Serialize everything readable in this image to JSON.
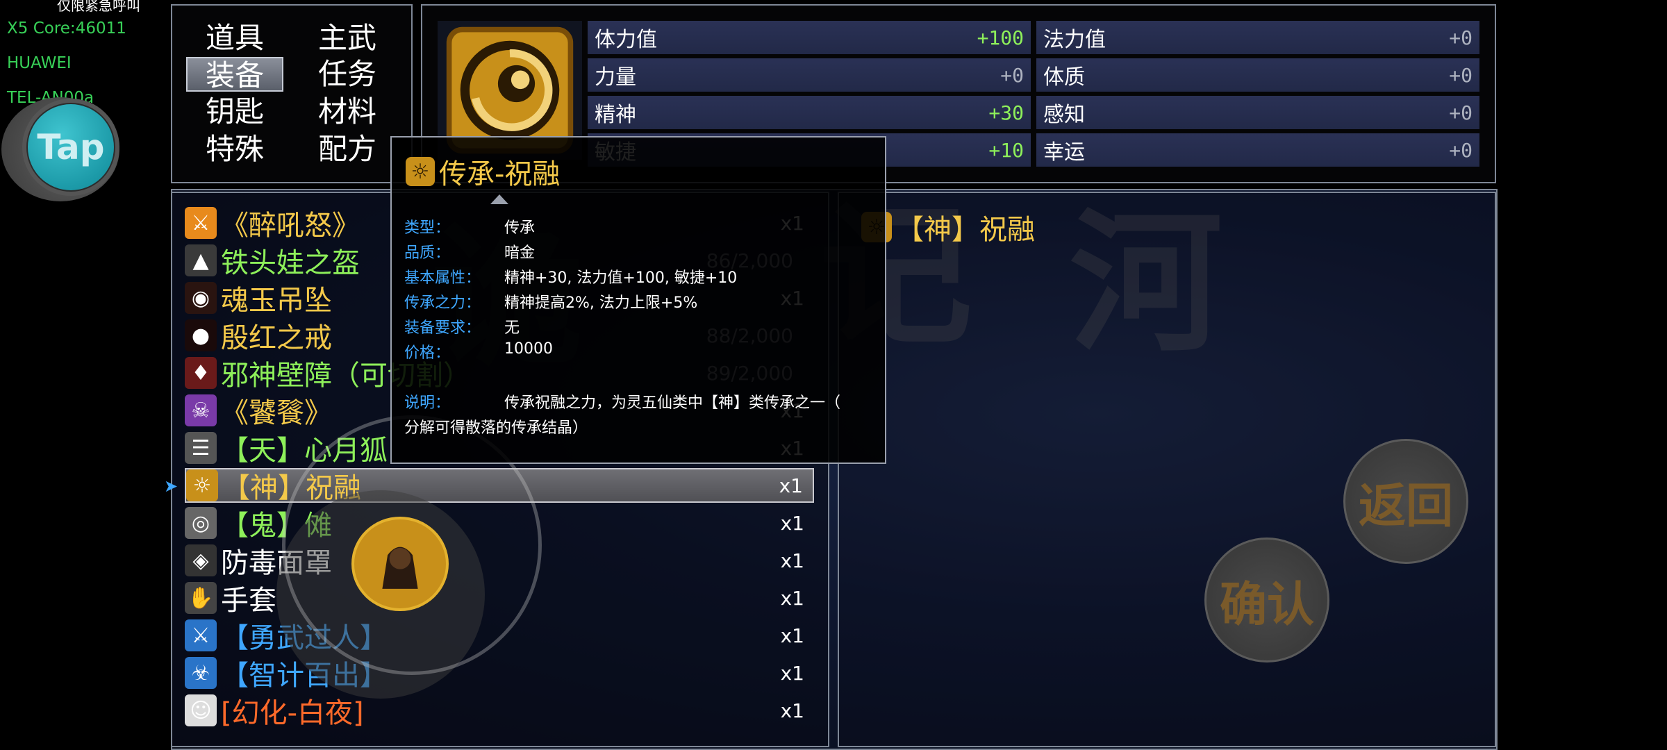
{
  "overlay": {
    "top_text": "仅限紧急呼叫",
    "lines": [
      "X5 Core:46011",
      "HUAWEI",
      "TEL-AN00a"
    ],
    "tap_label": "Tap"
  },
  "tabs": [
    "道具",
    "主武",
    "装备",
    "任务",
    "钥匙",
    "材料",
    "特殊",
    "配方"
  ],
  "active_tab": "装备",
  "stats": [
    {
      "label": "体力值",
      "value": "+100",
      "highlight": true
    },
    {
      "label": "法力值",
      "value": "+0",
      "highlight": false
    },
    {
      "label": "力量",
      "value": "+0",
      "highlight": false
    },
    {
      "label": "体质",
      "value": "+0",
      "highlight": false
    },
    {
      "label": "精神",
      "value": "+30",
      "highlight": true
    },
    {
      "label": "感知",
      "value": "+0",
      "highlight": false
    },
    {
      "label": "敏捷",
      "value": "+10",
      "highlight": true
    },
    {
      "label": "幸运",
      "value": "+0",
      "highlight": false
    }
  ],
  "items": [
    {
      "name": "《醉吼怒》",
      "color": "#f4c94a",
      "count": "x1",
      "icon": "tiger-icon"
    },
    {
      "name": "铁头娃之盔",
      "color": "#8ef05a",
      "count": "86/2,000",
      "icon": "helmet-icon"
    },
    {
      "name": "魂玉吊坠",
      "color": "#f4c94a",
      "count": "x1",
      "icon": "pendant-icon"
    },
    {
      "name": "殷红之戒",
      "color": "#f4c94a",
      "count": "88/2,000",
      "icon": "ring-icon"
    },
    {
      "name": "邪神壁障（可切割）",
      "color": "#8ef05a",
      "count": "89/2,000",
      "icon": "shield-icon"
    },
    {
      "name": "《饕餮》",
      "color": "#f4c94a",
      "count": "x1",
      "icon": "beast-icon"
    },
    {
      "name": "【天】心月狐",
      "color": "#8ef05a",
      "count": "x1",
      "icon": "fox-icon"
    },
    {
      "name": "【神】祝融",
      "color": "#f4c94a",
      "count": "x1",
      "icon": "sun-icon",
      "selected": true
    },
    {
      "name": "【鬼】傩",
      "color": "#8ef05a",
      "count": "x1",
      "icon": "mask-icon"
    },
    {
      "name": "防毒面罩",
      "color": "#ffffff",
      "count": "x1",
      "icon": "gasmask-icon"
    },
    {
      "name": "手套",
      "color": "#ffffff",
      "count": "x1",
      "icon": "glove-icon"
    },
    {
      "name": "【勇武过人】",
      "color": "#3fa7ff",
      "count": "x1",
      "icon": "sword-icon"
    },
    {
      "name": "【智计百出】",
      "color": "#3fa7ff",
      "count": "x1",
      "icon": "biohazard-icon"
    },
    {
      "name": "[幻化-白夜]",
      "color": "#ff6a2a",
      "count": "x1",
      "icon": "character-icon"
    }
  ],
  "tooltip": {
    "title": "传承-祝融",
    "fields": [
      {
        "label": "类型：",
        "value": "传承"
      },
      {
        "label": "品质：",
        "value": "暗金"
      },
      {
        "label": "基本属性：",
        "value": "精神+30, 法力值+100, 敏捷+10"
      },
      {
        "label": "传承之力：",
        "value": "精神提高2%, 法力上限+5%"
      },
      {
        "label": "装备要求：",
        "value": "无"
      },
      {
        "label": "价格：",
        "value": "10000"
      },
      {
        "label": "说明：",
        "value": "传承祝融之力，为灵五仙类中【神】类传承之一（"
      }
    ],
    "desc_cont": "分解可得散落的传承结晶）"
  },
  "detail": {
    "title": "【神】祝融"
  },
  "buttons": {
    "back": "返回",
    "confirm": "确认"
  }
}
